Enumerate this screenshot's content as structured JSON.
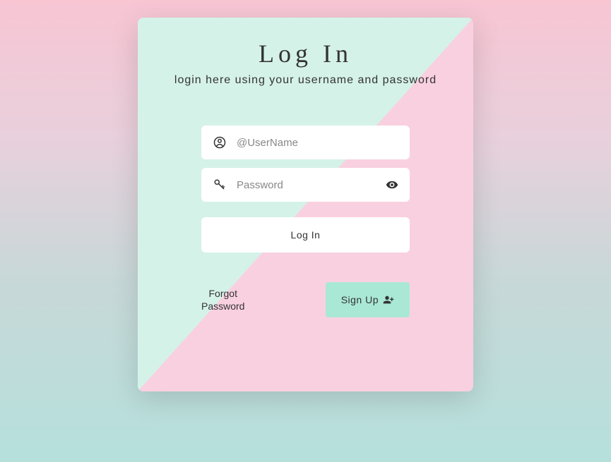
{
  "card": {
    "title": "Log In",
    "subtitle": "login here using your username and password"
  },
  "form": {
    "username": {
      "placeholder": "@UserName",
      "value": ""
    },
    "password": {
      "placeholder": "Password",
      "value": ""
    },
    "login_button": "Log In"
  },
  "actions": {
    "forgot_line1": "Forgot",
    "forgot_line2": "Password",
    "signup_label": "Sign Up"
  }
}
